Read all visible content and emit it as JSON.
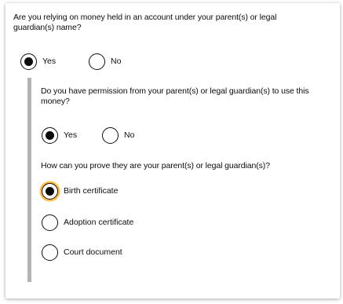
{
  "q1": {
    "question": "Are you relying on money held in an account under your parent(s) or legal guardian(s) name?",
    "options": [
      "Yes",
      "No"
    ],
    "selected": "Yes"
  },
  "q2": {
    "question": "Do you have permission from your parent(s) or legal guardian(s) to use this money?",
    "options": [
      "Yes",
      "No"
    ],
    "selected": "Yes"
  },
  "q3": {
    "question": "How can you prove they are your parent(s) or legal guardian(s)?",
    "options": [
      "Birth certificate",
      "Adoption certificate",
      "Court document"
    ],
    "selected": "Birth certificate"
  },
  "colors": {
    "text": "#0b0c0c",
    "focus": "#ffbf47",
    "inset_border": "#b1b4b6"
  }
}
